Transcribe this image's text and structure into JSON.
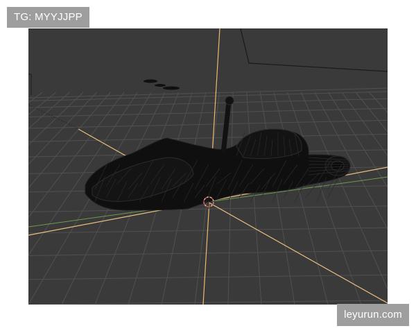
{
  "watermarks": {
    "top_left": "TG: MYYJJPP",
    "bottom_right": "leyurun.com"
  },
  "viewport": {
    "background": "#3a3a3a",
    "grid_color": "#555555",
    "axis_x_color": "#e8c28a",
    "axis_y_color": "#7da85f",
    "axis_z_color": "#f0b870",
    "model_color": "#0e0e0e",
    "model_wire_color": "#262626",
    "object_icon": "wireframe-vehicle-icon",
    "cursor_icon": "3d-cursor-icon"
  }
}
